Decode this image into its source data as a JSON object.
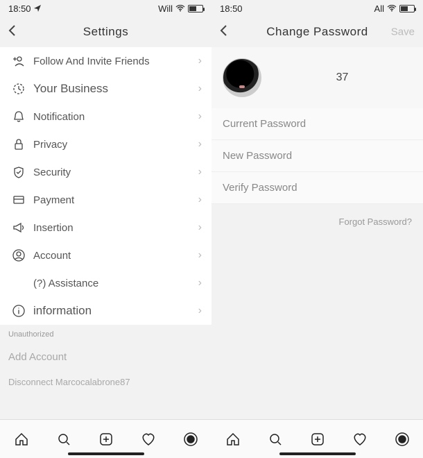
{
  "left": {
    "status": {
      "time": "18:50",
      "carrier": "Will"
    },
    "header": {
      "title": "Settings"
    },
    "menu": [
      {
        "icon": "add-person-icon",
        "label": "Follow And Invite Friends"
      },
      {
        "icon": "clock-icon",
        "label": "Your Business",
        "emph": true
      },
      {
        "icon": "bell-icon",
        "label": "Notification"
      },
      {
        "icon": "lock-icon",
        "label": "Privacy"
      },
      {
        "icon": "shield-icon",
        "label": "Security"
      },
      {
        "icon": "card-icon",
        "label": "Payment"
      },
      {
        "icon": "megaphone-icon",
        "label": "Insertion"
      },
      {
        "icon": "account-icon",
        "label": "Account"
      },
      {
        "icon": "help-icon",
        "label": "(?) Assistance"
      },
      {
        "icon": "info-icon",
        "label": "information"
      }
    ],
    "section_note": "Unauthorized",
    "add_account": "Add Account",
    "disconnect": "Disconnect Marcocalabrone87"
  },
  "right": {
    "status": {
      "time": "18:50",
      "carrier": "All"
    },
    "header": {
      "title": "Change Password",
      "save": "Save"
    },
    "profile": {
      "value": "37"
    },
    "fields": {
      "current": "Current Password",
      "new": "New Password",
      "verify": "Verify Password"
    },
    "forgot": "Forgot Password?"
  }
}
